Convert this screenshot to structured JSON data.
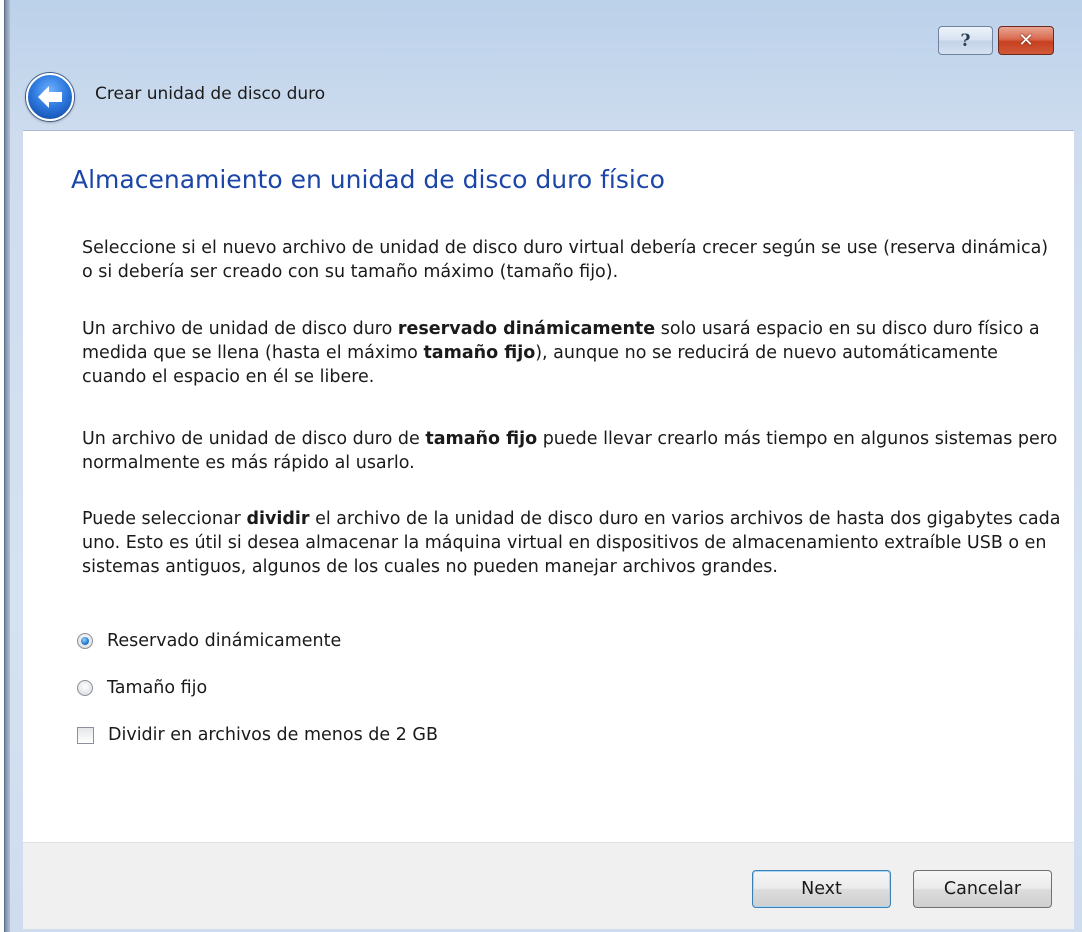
{
  "window": {
    "help_symbol": "?",
    "close_symbol": "✕"
  },
  "header": {
    "title": "Crear unidad de disco duro"
  },
  "page": {
    "title": "Almacenamiento en unidad de disco duro físico",
    "para1": "Seleccione si el nuevo archivo de unidad de disco duro virtual debería crecer según se use (reserva dinámica) o si debería ser creado con su tamaño máximo (tamaño fijo).",
    "para2": {
      "a": "Un archivo de unidad de disco duro ",
      "b": "reservado dinámicamente",
      "c": " solo usará espacio en su disco duro físico a medida que se llena (hasta el máximo ",
      "d": "tamaño fijo",
      "e": "), aunque no se reducirá de nuevo automáticamente cuando el espacio en él se libere."
    },
    "para3": {
      "a": "Un archivo de unidad de disco duro de ",
      "b": "tamaño fijo",
      "c": " puede llevar crearlo más tiempo en algunos sistemas pero normalmente es más rápido al usarlo."
    },
    "para4": {
      "a": "Puede seleccionar ",
      "b": "dividir",
      "c": " el archivo de la unidad de disco duro en varios archivos de hasta dos gigabytes cada uno. Esto es útil si desea almacenar la máquina virtual en dispositivos de almacenamiento extraíble USB o en sistemas antiguos, algunos de los cuales no pueden manejar archivos grandes."
    }
  },
  "options": {
    "dynamic_label": "Reservado dinámicamente",
    "dynamic_checked": true,
    "fixed_label": "Tamaño fijo",
    "fixed_checked": false,
    "split_label": "Dividir en archivos de menos de 2 GB",
    "split_checked": false
  },
  "footer": {
    "next_label": "Next",
    "cancel_label": "Cancelar"
  },
  "icons": {
    "back": "back-arrow-icon",
    "help": "help-icon",
    "close": "close-icon"
  }
}
